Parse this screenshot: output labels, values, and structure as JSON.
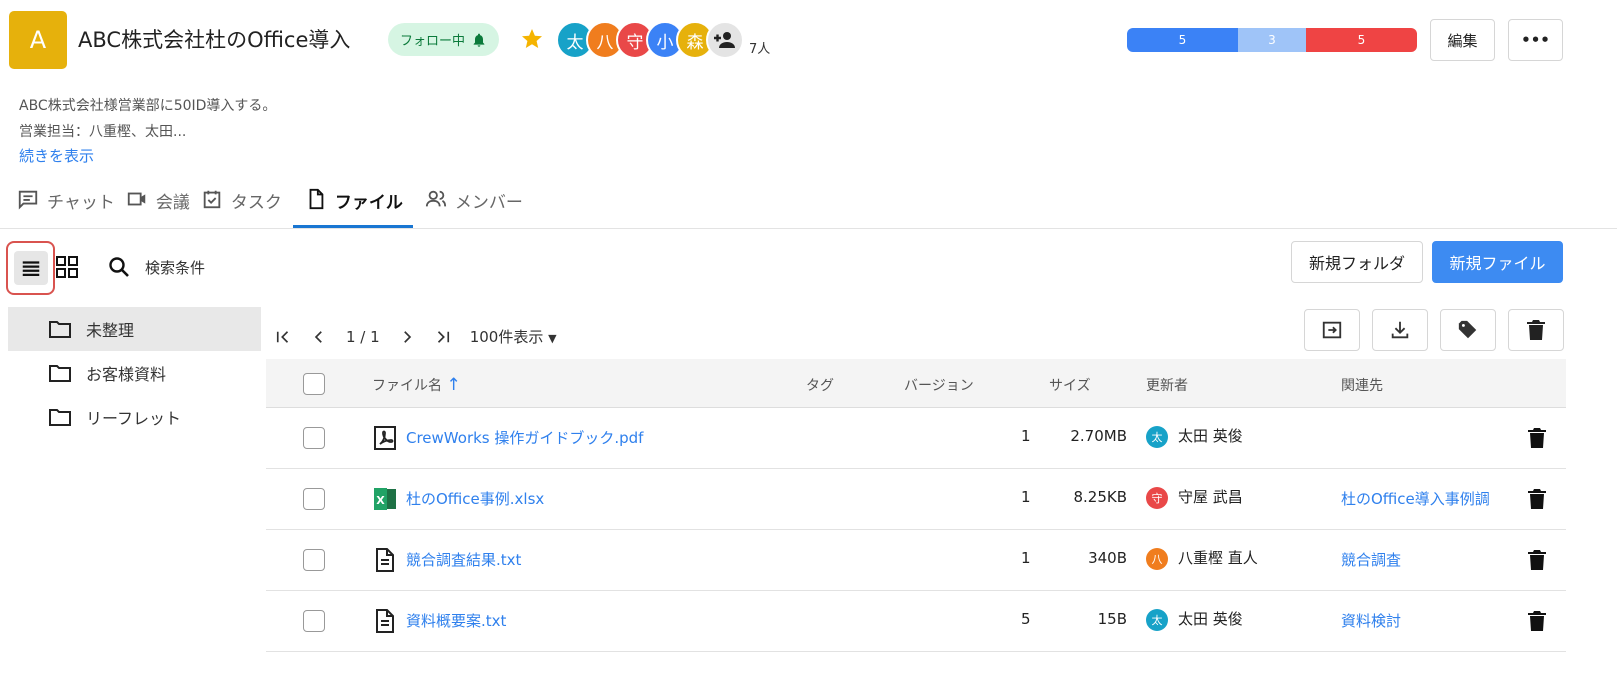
{
  "project": {
    "avatar_letter": "A",
    "title": "ABC株式会社杜のOffice導入",
    "follow_label": "フォロー中",
    "member_count": "7人",
    "members": [
      {
        "initial": "太",
        "color": "#17a2c8"
      },
      {
        "initial": "八",
        "color": "#f07d1e"
      },
      {
        "initial": "守",
        "color": "#e94848"
      },
      {
        "initial": "小",
        "color": "#3b82f6"
      },
      {
        "initial": "森",
        "color": "#e6b10c"
      }
    ],
    "status_counts": [
      {
        "value": "5",
        "color": "#3b82f6"
      },
      {
        "value": "3",
        "color": "#9fc4f8"
      },
      {
        "value": "5",
        "color": "#ef4444"
      }
    ],
    "edit_label": "編集",
    "more_label": "•••",
    "description_lines": [
      "ABC株式会社様営業部に50ID導入する。",
      "営業担当：八重樫、太田..."
    ],
    "show_more": "続きを表示"
  },
  "tabs": [
    {
      "label": "チャット",
      "icon": "chat-icon"
    },
    {
      "label": "会議",
      "icon": "video-icon"
    },
    {
      "label": "タスク",
      "icon": "task-icon"
    },
    {
      "label": "ファイル",
      "icon": "file-icon",
      "active": true
    },
    {
      "label": "メンバー",
      "icon": "members-icon"
    }
  ],
  "toolbar": {
    "search_label": "検索条件",
    "new_folder": "新規フォルダ",
    "new_file": "新規ファイル"
  },
  "folders": [
    {
      "name": "未整理",
      "selected": true
    },
    {
      "name": "お客様資料"
    },
    {
      "name": "リーフレット"
    }
  ],
  "pager": {
    "page": "1 / 1",
    "per_page": "100件表示"
  },
  "table": {
    "headers": {
      "name": "ファイル名",
      "tag": "タグ",
      "version": "バージョン",
      "size": "サイズ",
      "updater": "更新者",
      "related": "関連先"
    },
    "rows": [
      {
        "type": "pdf",
        "name": "CrewWorks 操作ガイドブック.pdf",
        "version": "1",
        "size": "2.70MB",
        "updater": "太田 英俊",
        "updater_initial": "太",
        "updater_color": "#17a2c8",
        "related": ""
      },
      {
        "type": "xlsx",
        "name": "杜のOffice事例.xlsx",
        "version": "1",
        "size": "8.25KB",
        "updater": "守屋 武昌",
        "updater_initial": "守",
        "updater_color": "#e94848",
        "related": "杜のOffice導入事例調"
      },
      {
        "type": "txt",
        "name": "競合調査結果.txt",
        "version": "1",
        "size": "340B",
        "updater": "八重樫 直人",
        "updater_initial": "八",
        "updater_color": "#f07d1e",
        "related": "競合調査"
      },
      {
        "type": "txt",
        "name": "資料概要案.txt",
        "version": "5",
        "size": "15B",
        "updater": "太田 英俊",
        "updater_initial": "太",
        "updater_color": "#17a2c8",
        "related": "資料検討"
      }
    ]
  }
}
